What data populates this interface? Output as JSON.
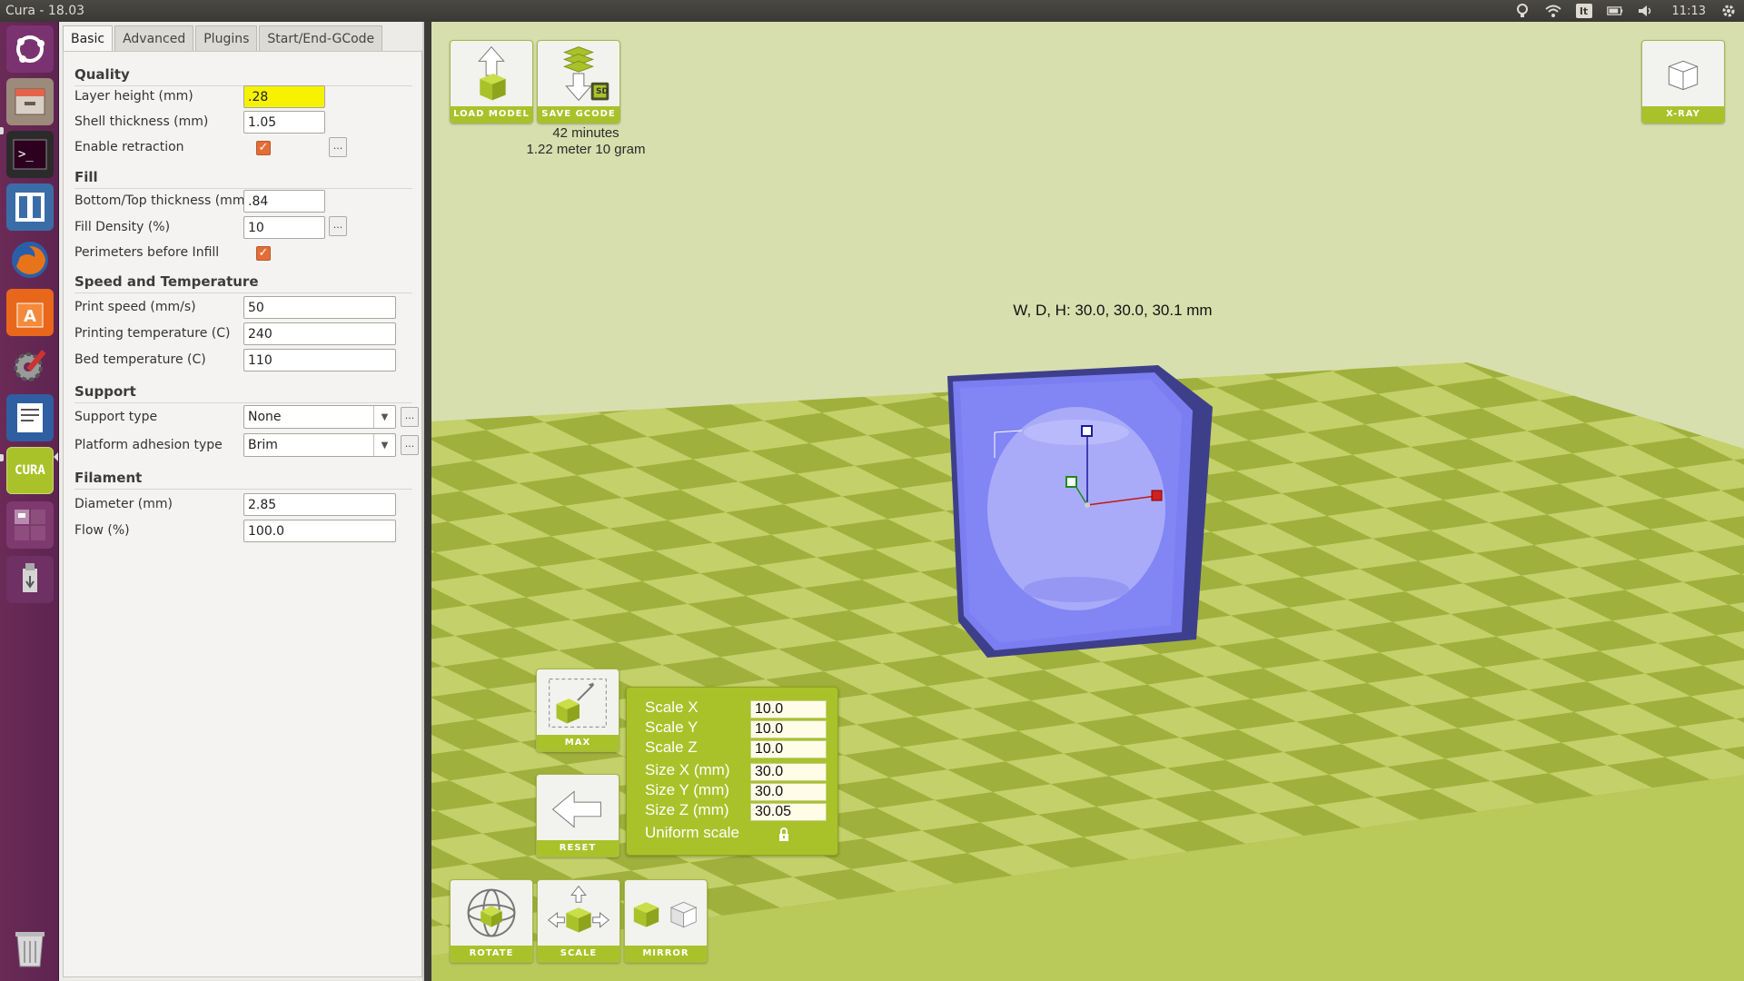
{
  "topbar": {
    "title": "Cura - 18.03",
    "keyboard": "It",
    "time": "11:13"
  },
  "tabs": [
    {
      "label": "Basic"
    },
    {
      "label": "Advanced"
    },
    {
      "label": "Plugins"
    },
    {
      "label": "Start/End-GCode"
    }
  ],
  "quality": {
    "heading": "Quality",
    "layer_height_label": "Layer height (mm)",
    "layer_height": ".28",
    "shell_thickness_label": "Shell thickness (mm)",
    "shell_thickness": "1.05",
    "enable_retraction_label": "Enable retraction",
    "enable_retraction": true
  },
  "fill": {
    "heading": "Fill",
    "bottom_top_label": "Bottom/Top thickness (mm)",
    "bottom_top": ".84",
    "density_label": "Fill Density (%)",
    "density": "10",
    "perimeters_label": "Perimeters before Infill",
    "perimeters": true
  },
  "speed": {
    "heading": "Speed and Temperature",
    "print_speed_label": "Print speed (mm/s)",
    "print_speed": "50",
    "print_temp_label": "Printing temperature (C)",
    "print_temp": "240",
    "bed_temp_label": "Bed temperature (C)",
    "bed_temp": "110"
  },
  "support": {
    "heading": "Support",
    "type_label": "Support type",
    "type": "None",
    "adhesion_label": "Platform adhesion type",
    "adhesion": "Brim"
  },
  "filament": {
    "heading": "Filament",
    "diameter_label": "Diameter (mm)",
    "diameter": "2.85",
    "flow_label": "Flow (%)",
    "flow": "100.0"
  },
  "more_button": "...",
  "viewport": {
    "load_model": "LOAD MODEL",
    "save_gcode": "SAVE GCODE",
    "sd_badge": "SD",
    "print_time": "42 minutes",
    "print_material": "1.22 meter 10 gram",
    "xray": "X-RAY",
    "dimensions": "W, D, H: 30.0, 30.0, 30.1 mm",
    "max": "MAX",
    "reset": "RESET",
    "rotate": "ROTATE",
    "scale": "SCALE",
    "mirror": "MIRROR",
    "model_color": "#7b7ef0",
    "accent": "#a9c22a"
  },
  "scale_panel": {
    "scale_x_label": "Scale X",
    "scale_x": "10.0",
    "scale_y_label": "Scale Y",
    "scale_y": "10.0",
    "scale_z_label": "Scale Z",
    "scale_z": "10.0",
    "size_x_label": "Size X (mm)",
    "size_x": "30.0",
    "size_y_label": "Size Y (mm)",
    "size_y": "30.0",
    "size_z_label": "Size Z (mm)",
    "size_z": "30.05",
    "uniform_label": "Uniform scale",
    "uniform_locked": true
  },
  "launcher": [
    {
      "name": "ubuntu-dash-icon"
    },
    {
      "name": "files-icon"
    },
    {
      "name": "terminal-icon"
    },
    {
      "name": "app-icon"
    },
    {
      "name": "firefox-icon"
    },
    {
      "name": "software-center-icon"
    },
    {
      "name": "system-settings-icon"
    },
    {
      "name": "text-editor-icon"
    },
    {
      "name": "cura-icon",
      "label": "CURA"
    },
    {
      "name": "workspace-switcher-icon"
    },
    {
      "name": "usb-drive-icon"
    },
    {
      "name": "trash-icon"
    }
  ]
}
